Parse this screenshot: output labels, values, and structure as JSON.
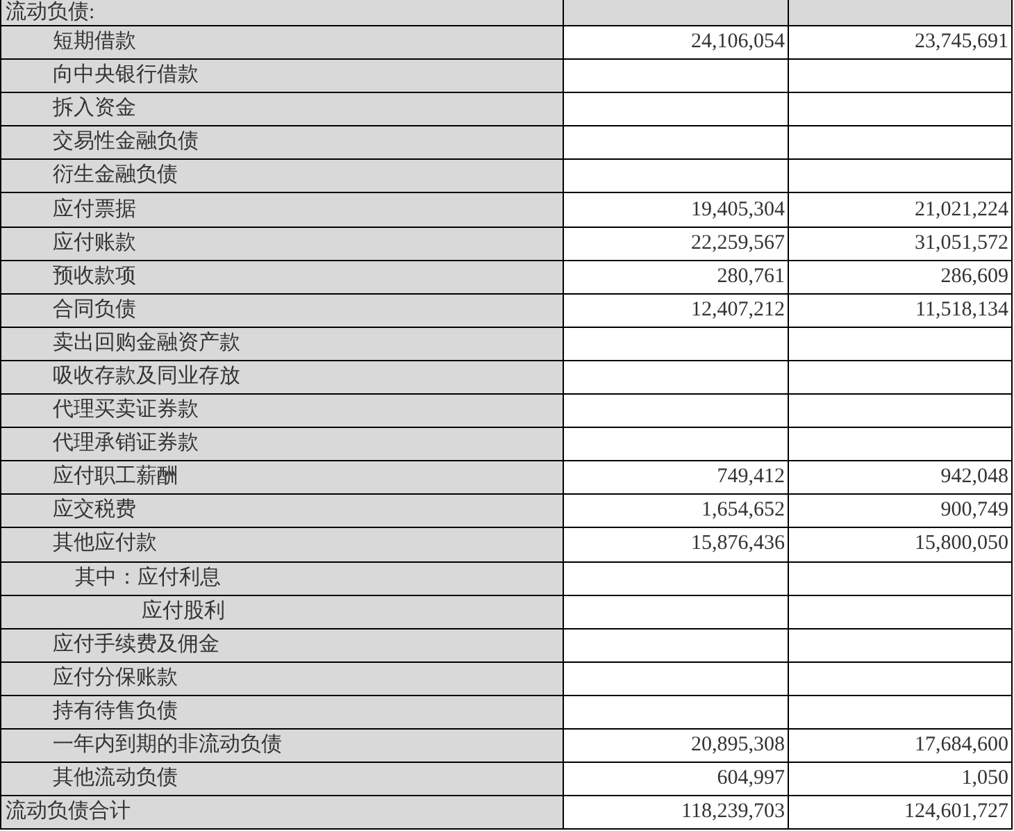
{
  "section": {
    "label": "流动负债:"
  },
  "rows": [
    {
      "label": "短期借款",
      "kind": "item",
      "values": [
        "24,106,054",
        "23,745,691"
      ]
    },
    {
      "label": "向中央银行借款",
      "kind": "item",
      "values": []
    },
    {
      "label": "拆入资金",
      "kind": "item",
      "values": []
    },
    {
      "label": "交易性金融负债",
      "kind": "item",
      "values": []
    },
    {
      "label": "衍生金融负债",
      "kind": "item",
      "values": []
    },
    {
      "label": "应付票据",
      "kind": "item",
      "values": [
        "19,405,304",
        "21,021,224"
      ]
    },
    {
      "label": "应付账款",
      "kind": "item",
      "values": [
        "22,259,567",
        "31,051,572"
      ]
    },
    {
      "label": "预收款项",
      "kind": "item",
      "values": [
        "280,761",
        "286,609"
      ]
    },
    {
      "label": "合同负债",
      "kind": "item",
      "values": [
        "12,407,212",
        "11,518,134"
      ]
    },
    {
      "label": "卖出回购金融资产款",
      "kind": "item",
      "values": []
    },
    {
      "label": "吸收存款及同业存放",
      "kind": "item",
      "values": []
    },
    {
      "label": "代理买卖证券款",
      "kind": "item",
      "values": []
    },
    {
      "label": "代理承销证券款",
      "kind": "item",
      "values": []
    },
    {
      "label": "应付职工薪酬",
      "kind": "item",
      "values": [
        "749,412",
        "942,048"
      ]
    },
    {
      "label": "应交税费",
      "kind": "item",
      "values": [
        "1,654,652",
        "900,749"
      ]
    },
    {
      "label": "其他应付款",
      "kind": "item",
      "values": [
        "15,876,436",
        "15,800,050"
      ]
    },
    {
      "label": "其中：应付利息",
      "kind": "sub-first",
      "values": []
    },
    {
      "label": "应付股利",
      "kind": "sub",
      "values": []
    },
    {
      "label": "应付手续费及佣金",
      "kind": "item",
      "values": []
    },
    {
      "label": "应付分保账款",
      "kind": "item",
      "values": []
    },
    {
      "label": "持有待售负债",
      "kind": "item",
      "values": []
    },
    {
      "label": "一年内到期的非流动负债",
      "kind": "item",
      "values": [
        "20,895,308",
        "17,684,600"
      ]
    },
    {
      "label": "其他流动负债",
      "kind": "item",
      "values": [
        "604,997",
        "1,050"
      ]
    },
    {
      "label": "流动负债合计",
      "kind": "total",
      "values": [
        "118,239,703",
        "124,601,727"
      ]
    }
  ]
}
